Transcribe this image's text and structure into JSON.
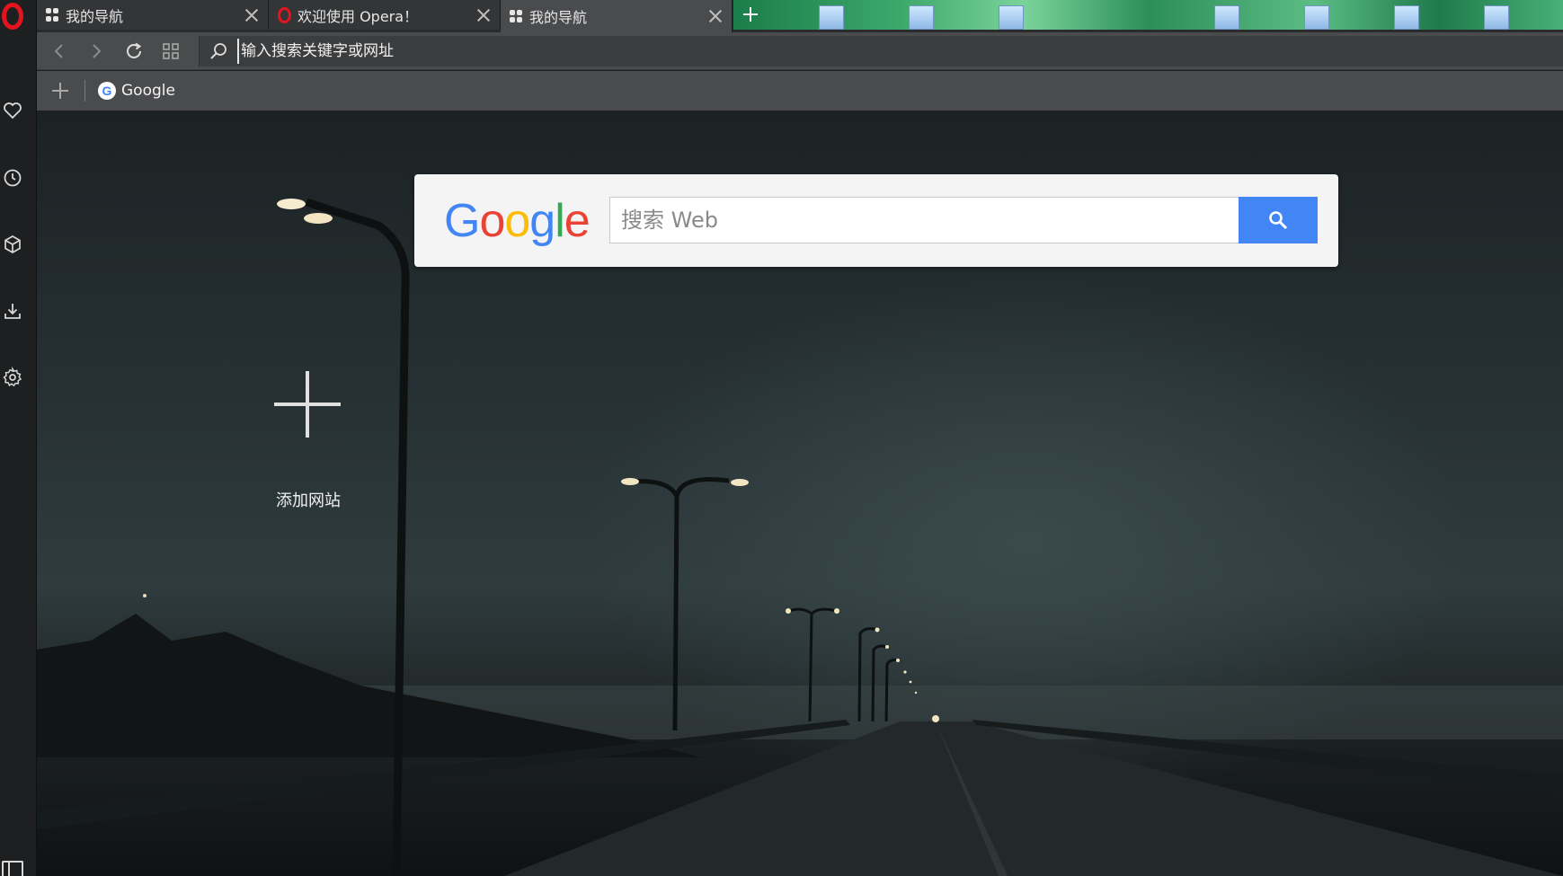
{
  "tabs": [
    {
      "title": "我的导航",
      "icon": "speed-dial-grid-icon"
    },
    {
      "title": "欢迎使用 Opera！",
      "icon": "opera-logo-icon"
    },
    {
      "title": "我的导航",
      "icon": "speed-dial-grid-icon",
      "active": true
    }
  ],
  "toolbar": {
    "address_placeholder": "输入搜索关键字或网址"
  },
  "bookmarks": {
    "items": [
      {
        "label": "Google",
        "icon": "google-g-icon"
      }
    ]
  },
  "search": {
    "logo_text": "Google",
    "placeholder": "搜索 Web"
  },
  "speed_dial": {
    "add_site_label": "添加网站"
  },
  "sidebar": {
    "icons": [
      "heart-icon",
      "clock-icon",
      "cube-icon",
      "download-icon",
      "gear-icon"
    ]
  },
  "colors": {
    "opera_red": "#e3141f",
    "google_blue": "#4285f4",
    "google_red": "#ea4335",
    "google_yellow": "#fbbc05",
    "google_green": "#34a853"
  }
}
